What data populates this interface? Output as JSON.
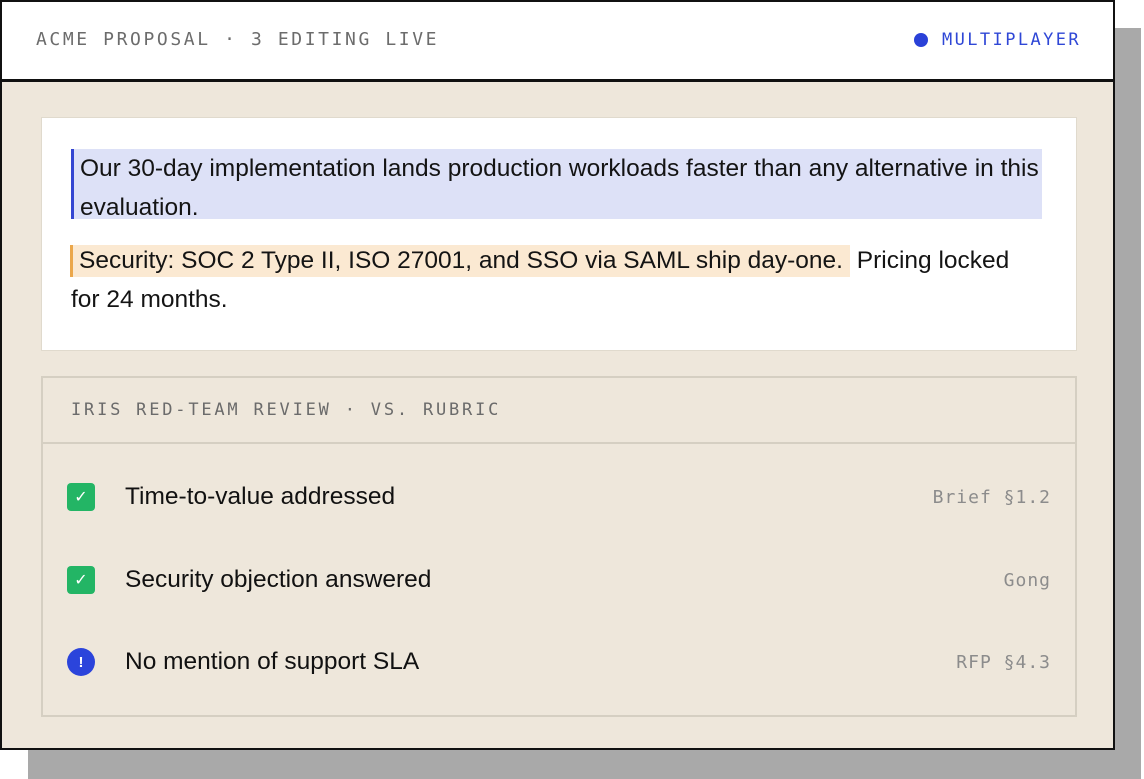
{
  "header": {
    "title": "ACME PROPOSAL · 3 EDITING LIVE",
    "status_label": "MULTIPLAYER",
    "status_color": "#2a41d8"
  },
  "document": {
    "paragraph1": "Our 30-day implementation lands production workloads faster than any alternative in this evaluation.",
    "paragraph2_highlight": "Security: SOC 2 Type II, ISO 27001, and SSO via SAML ship day-one.",
    "paragraph2_rest": "Pricing locked for 24 months.",
    "highlight_colors": {
      "blue": "#dde1f7",
      "orange": "#fbe9d2"
    }
  },
  "review": {
    "title": "IRIS RED-TEAM REVIEW · VS. RUBRIC",
    "items": [
      {
        "status": "pass",
        "icon": "check-icon",
        "glyph": "✓",
        "label": "Time-to-value addressed",
        "source": "Brief §1.2"
      },
      {
        "status": "pass",
        "icon": "check-icon",
        "glyph": "✓",
        "label": "Security objection answered",
        "source": "Gong"
      },
      {
        "status": "warning",
        "icon": "alert-icon",
        "glyph": "!",
        "label": "No mention of support SLA",
        "source": "RFP §4.3"
      }
    ]
  }
}
